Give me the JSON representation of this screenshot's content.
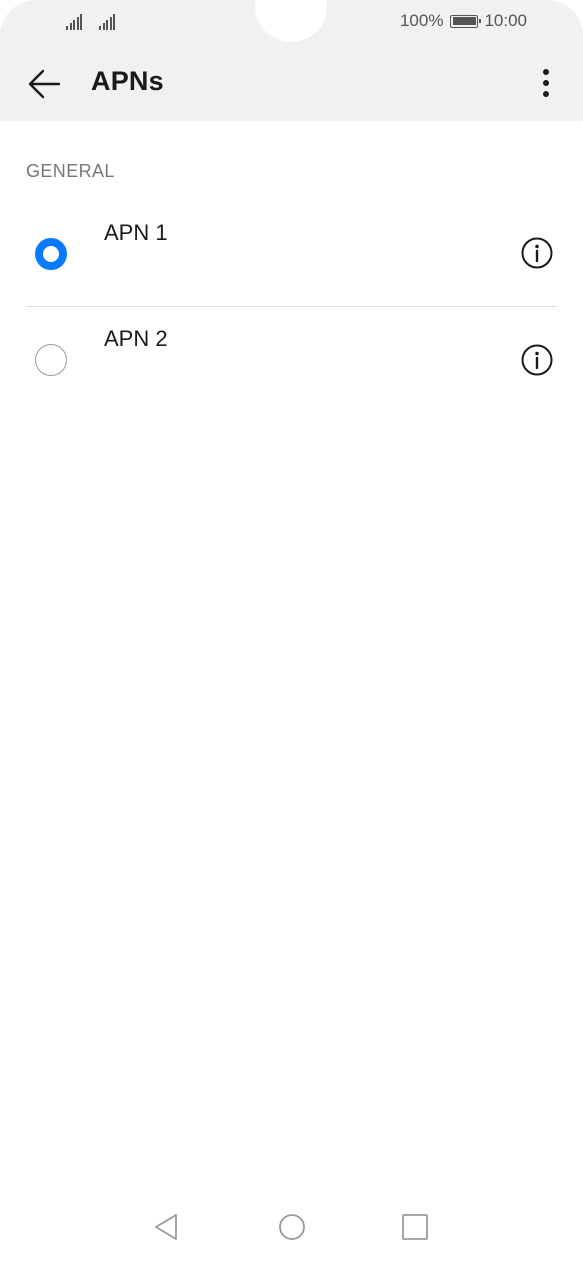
{
  "status_bar": {
    "battery_percent": "100%",
    "time": "10:00",
    "icons": [
      "signal-icon",
      "signal-icon",
      "battery-icon"
    ]
  },
  "toolbar": {
    "title": "APNs",
    "back_icon": "back-arrow-icon",
    "more_icon": "more-vertical-icon"
  },
  "section": {
    "header": "GENERAL"
  },
  "apns": [
    {
      "name": "APN 1",
      "selected": true,
      "info_icon": "info-icon"
    },
    {
      "name": "APN 2",
      "selected": false,
      "info_icon": "info-icon"
    }
  ],
  "nav_bar": {
    "icons": [
      "nav-back-icon",
      "nav-home-icon",
      "nav-recents-icon"
    ]
  },
  "colors": {
    "accent": "#0a7bff",
    "header_bg": "#f1f1f1",
    "section_text": "#777777"
  }
}
